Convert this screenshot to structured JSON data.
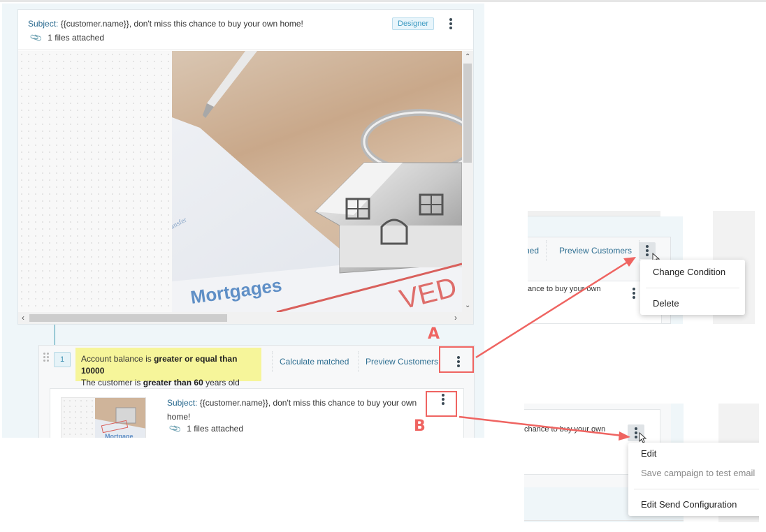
{
  "email": {
    "subject_label": "Subject:",
    "subject_text": "{{customer.name}}, don't miss this chance to buy your own home!",
    "attachments": "1 files attached",
    "badge": "Designer",
    "image_text": "Mortgages"
  },
  "condition": {
    "index": "1",
    "line1_prefix": "Account balance is ",
    "line1_bold": "greater or equal than 10000",
    "line2_prefix": "The customer is ",
    "line2_bold": "greater than 60",
    "line2_suffix": " years old",
    "calculate_label": "Calculate matched",
    "preview_label": "Preview Customers"
  },
  "sub_email": {
    "subject_label": "Subject:",
    "subject_text": "{{customer.name}}, don't miss this chance to buy your own home!",
    "attachments": "1 files attached"
  },
  "annotations": {
    "a": "A",
    "b": "B",
    "color": "#ef6461"
  },
  "callout_a": {
    "partial_left": "hed",
    "preview_label": "Preview Customers",
    "snippet": "ance to buy your own",
    "menu": [
      {
        "label": "Change Condition",
        "disabled": false
      },
      {
        "label": "Delete",
        "disabled": false
      }
    ]
  },
  "callout_b": {
    "snippet": "chance to buy your own",
    "menu": [
      {
        "label": "Edit",
        "disabled": false
      },
      {
        "label": "Save campaign to test email",
        "disabled": true
      },
      {
        "label": "Edit Send Configuration",
        "disabled": false
      }
    ]
  }
}
